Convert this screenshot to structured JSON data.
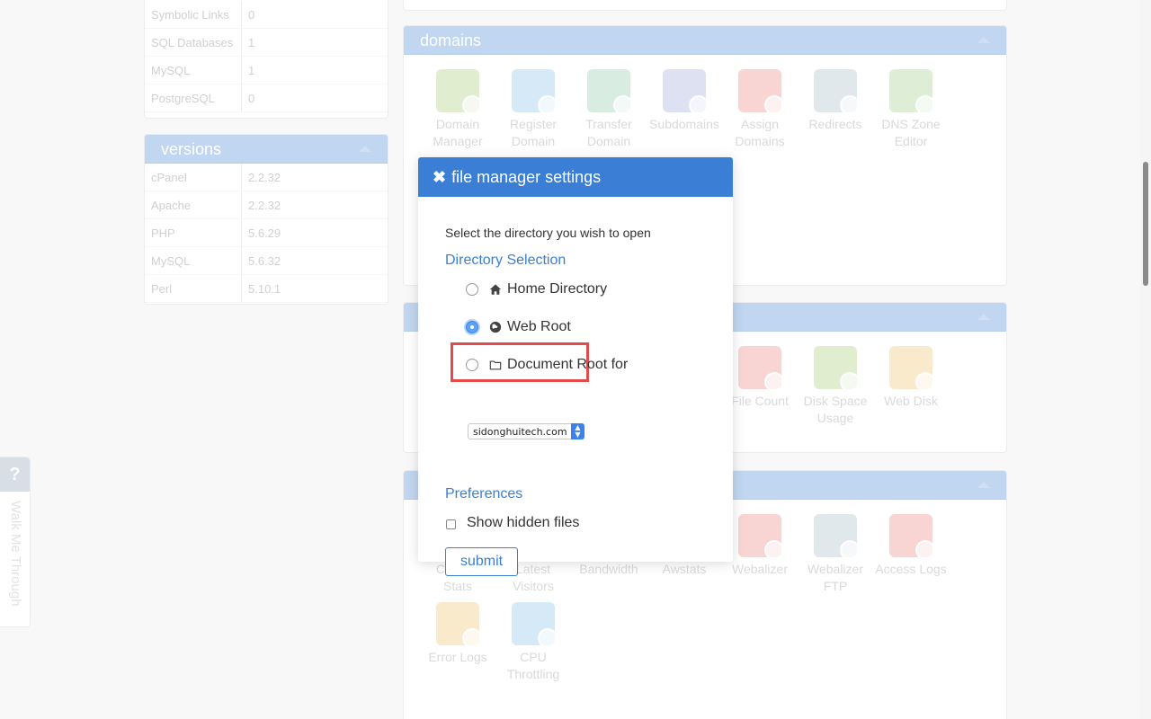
{
  "stats": [
    {
      "label": "Symbolic Links",
      "value": "0"
    },
    {
      "label": "SQL Databases",
      "value": "1"
    },
    {
      "label": "MySQL",
      "value": "1"
    },
    {
      "label": "PostgreSQL",
      "value": "0"
    }
  ],
  "versions": {
    "title": "versions",
    "rows": [
      {
        "label": "cPanel",
        "value": "2.2.32"
      },
      {
        "label": "Apache",
        "value": "2.2.32"
      },
      {
        "label": "PHP",
        "value": "5.6.29"
      },
      {
        "label": "MySQL",
        "value": "5.6.32"
      },
      {
        "label": "Perl",
        "value": "5.10.1"
      }
    ]
  },
  "domains": {
    "title": "domains",
    "items": [
      {
        "label": "Domain Manager",
        "icon": "gear-globe-icon",
        "color": "green"
      },
      {
        "label": "Register Domain",
        "icon": "star-globe-icon",
        "color": "blue"
      },
      {
        "label": "Transfer Domain",
        "icon": "arrow-globe-icon",
        "color": "teal"
      },
      {
        "label": "Subdomains",
        "icon": "subdomains-icon",
        "color": "purple"
      },
      {
        "label": "Assign Domains",
        "icon": "plus-globe-icon",
        "color": "red"
      },
      {
        "label": "Redirects",
        "icon": "redirect-icon",
        "color": "gray"
      },
      {
        "label": "DNS Zone Editor",
        "icon": "dns-zone-icon",
        "color": "lime"
      }
    ]
  },
  "files": {
    "items": [
      {
        "label": "File Count",
        "icon": "file-count-icon",
        "color": "red"
      },
      {
        "label": "Disk Space Usage",
        "icon": "disk-space-icon",
        "color": "green"
      },
      {
        "label": "Web Disk",
        "icon": "web-disk-icon",
        "color": "orange"
      }
    ]
  },
  "metrics": {
    "items": [
      {
        "label": "Choose Stats",
        "icon": "choose-stats-icon",
        "color": "blue"
      },
      {
        "label": "Latest Visitors",
        "icon": "visitors-icon",
        "color": "teal"
      },
      {
        "label": "Bandwidth",
        "icon": "bandwidth-icon",
        "color": "purple"
      },
      {
        "label": "Awstats",
        "icon": "awstats-icon",
        "color": "gray"
      },
      {
        "label": "Webalizer",
        "icon": "webalizer-icon",
        "color": "red"
      },
      {
        "label": "Webalizer FTP",
        "icon": "webalizer-ftp-icon",
        "color": "gray"
      },
      {
        "label": "Access Logs",
        "icon": "access-logs-icon",
        "color": "red"
      },
      {
        "label": "Error Logs",
        "icon": "error-logs-icon",
        "color": "orange"
      },
      {
        "label": "CPU Throttling",
        "icon": "cpu-throttling-icon",
        "color": "blue"
      }
    ]
  },
  "help": {
    "q": "?",
    "label": "Walk Me Through"
  },
  "modal": {
    "close_glyph": "✖",
    "title": "file manager settings",
    "intro": "Select the directory you wish to open",
    "directory_title": "Directory Selection",
    "options": {
      "home": "Home Directory",
      "webroot": "Web Root",
      "docroot": "Document Root for"
    },
    "selected": "webroot",
    "domain_select": "sidonghuitech.com",
    "preferences_title": "Preferences",
    "show_hidden_label": "Show hidden files",
    "show_hidden_checked": false,
    "submit_label": "submit"
  },
  "colors": {
    "accent": "#3a7fd5",
    "highlight": "#e24b4b"
  }
}
